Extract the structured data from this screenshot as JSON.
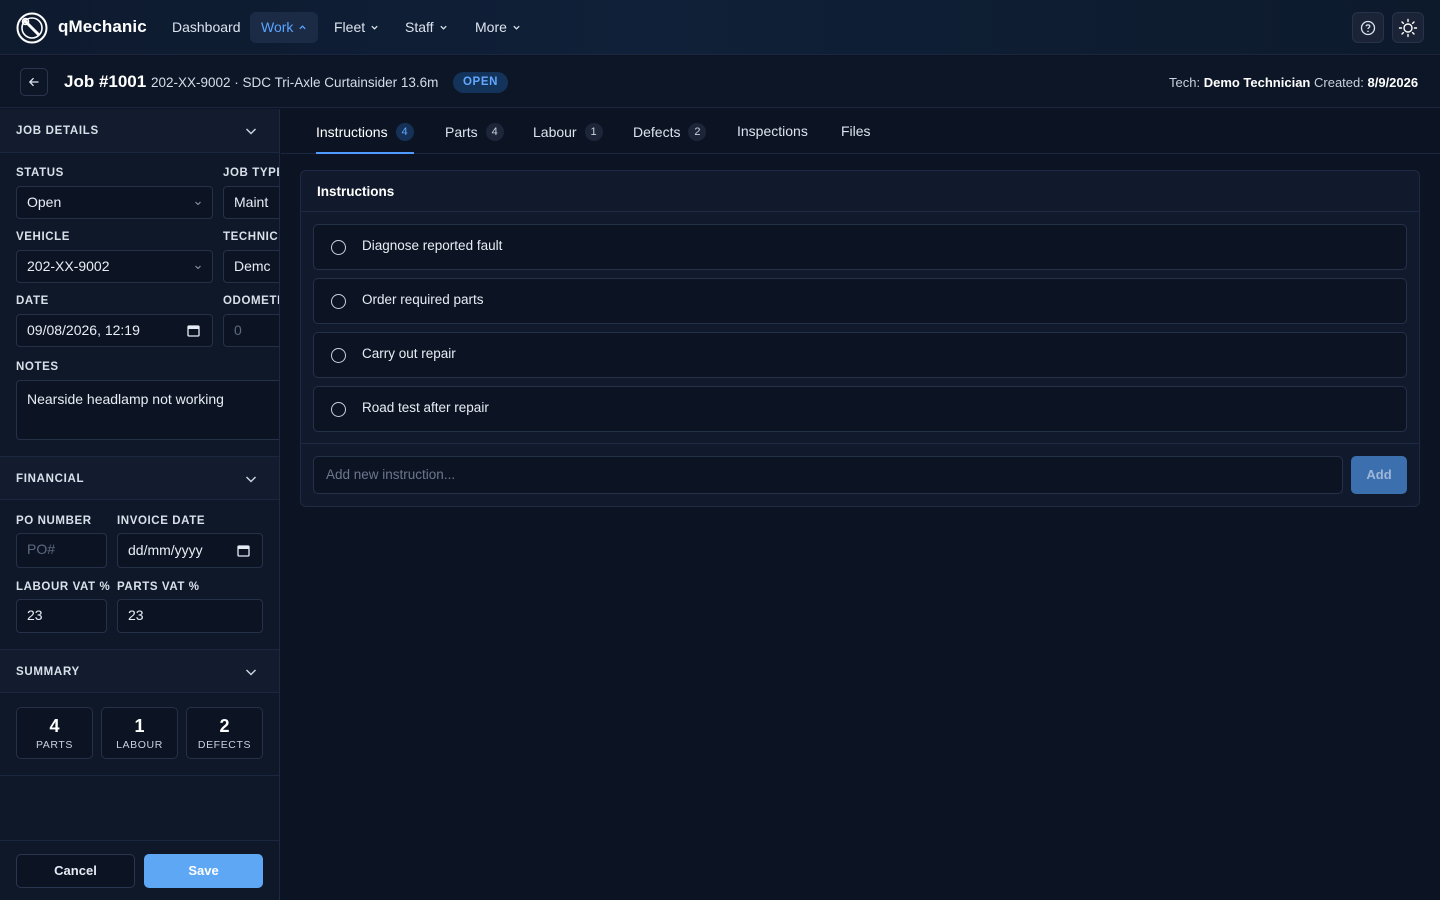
{
  "app": {
    "brand": "qMechanic"
  },
  "nav": {
    "items": [
      {
        "label": "Dashboard"
      },
      {
        "label": "Work"
      },
      {
        "label": "Fleet"
      },
      {
        "label": "Staff"
      },
      {
        "label": "More"
      }
    ],
    "active": "Work"
  },
  "job": {
    "title": "Job #1001",
    "subtitle": "202-XX-9002 · SDC Tri-Axle Curtainsider 13.6m",
    "status_badge": "OPEN",
    "tech_label": "Tech:",
    "tech_value": "Demo Technician",
    "created_label": "Created:",
    "created_value": "8/9/2026"
  },
  "sidebar": {
    "job_details": {
      "heading": "JOB DETAILS",
      "status_label": "STATUS",
      "status_value": "Open",
      "job_type_label": "JOB TYPE",
      "job_type_value": "Maint",
      "vehicle_label": "VEHICLE",
      "vehicle_value": "202-XX-9002",
      "technician_label": "TECHNICI",
      "technician_value": "Demc",
      "date_label": "DATE",
      "date_value": "09/08/2026, 12:19",
      "odometer_label": "ODOMETE",
      "odometer_placeholder": "0",
      "notes_label": "NOTES",
      "notes_value": "Nearside headlamp not working"
    },
    "financial": {
      "heading": "FINANCIAL",
      "po_label": "PO NUMBER",
      "po_placeholder": "PO#",
      "invoice_date_label": "INVOICE DATE",
      "invoice_date_placeholder": "dd/mm/yyyy",
      "labour_vat_label": "LABOUR VAT %",
      "labour_vat_value": "23",
      "parts_vat_label": "PARTS VAT %",
      "parts_vat_value": "23"
    },
    "summary": {
      "heading": "SUMMARY",
      "cards": [
        {
          "count": "4",
          "label": "PARTS"
        },
        {
          "count": "1",
          "label": "LABOUR"
        },
        {
          "count": "2",
          "label": "DEFECTS"
        }
      ]
    },
    "footer": {
      "cancel": "Cancel",
      "save": "Save"
    }
  },
  "tabs": [
    {
      "label": "Instructions",
      "count": "4"
    },
    {
      "label": "Parts",
      "count": "4"
    },
    {
      "label": "Labour",
      "count": "1"
    },
    {
      "label": "Defects",
      "count": "2"
    },
    {
      "label": "Inspections"
    },
    {
      "label": "Files"
    }
  ],
  "instructions": {
    "heading": "Instructions",
    "items": [
      {
        "text": "Diagnose reported fault"
      },
      {
        "text": "Order required parts"
      },
      {
        "text": "Carry out repair"
      },
      {
        "text": "Road test after repair"
      }
    ],
    "new_placeholder": "Add new instruction...",
    "add_label": "Add"
  },
  "colors": {
    "accent": "#4f9bff",
    "save_button": "#5ea7f5",
    "background": "#0c1424"
  }
}
